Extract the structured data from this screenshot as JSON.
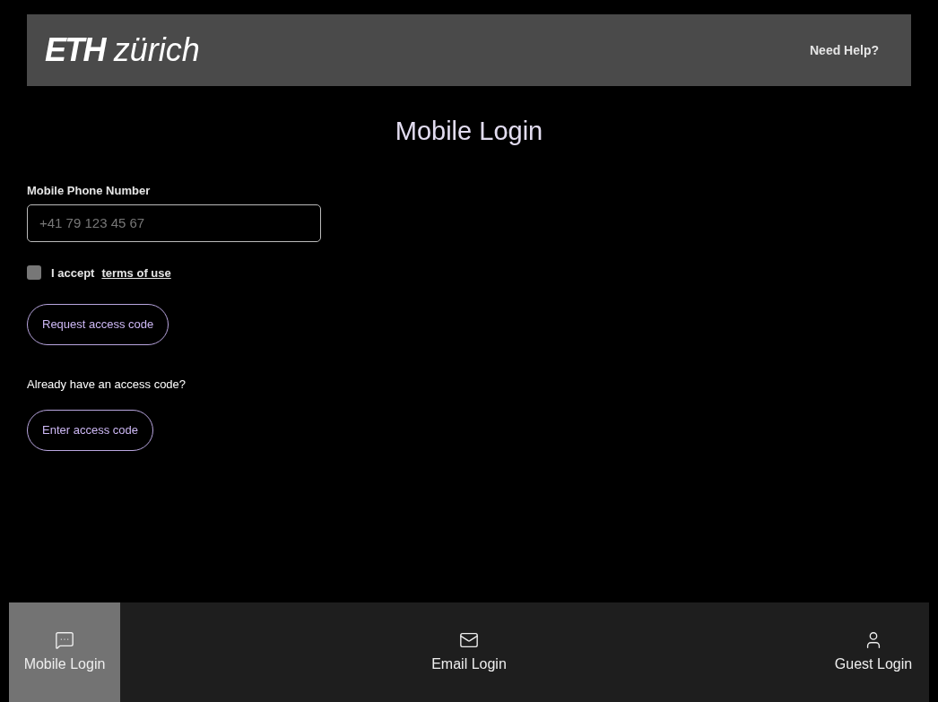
{
  "header": {
    "logo": {
      "bold": "ETH",
      "light": "zürich"
    },
    "help_link": "Need Help?"
  },
  "title": "Mobile Login",
  "form": {
    "phone_label": "Mobile Phone Number",
    "phone_placeholder": "+41 79 123 45 67",
    "accept": {
      "checked": false,
      "label": "I accept",
      "link": "terms of use"
    },
    "request_button": "Request access code",
    "already_text": "Already have an access code?",
    "enter_button": "Enter access code"
  },
  "bottom_nav": [
    {
      "kind": "chat",
      "label": "Mobile Login",
      "selected": true
    },
    {
      "kind": "mail",
      "label": "Email Login",
      "selected": false
    },
    {
      "kind": "user",
      "label": "Guest Login",
      "selected": false
    }
  ]
}
